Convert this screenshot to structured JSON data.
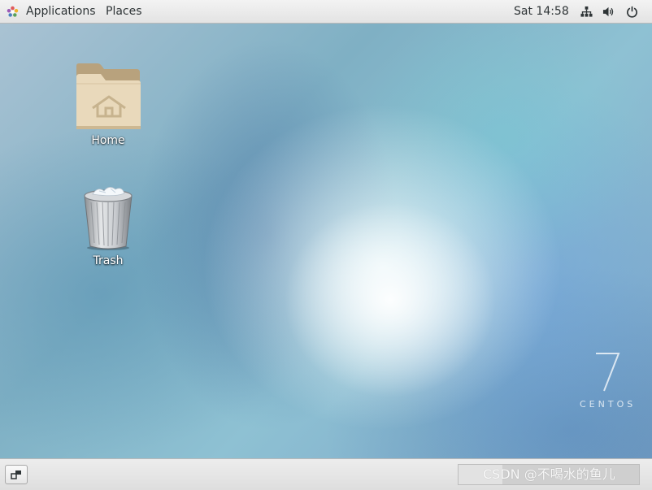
{
  "topbar": {
    "applications_label": "Applications",
    "places_label": "Places",
    "clock": "Sat 14:58",
    "icons": [
      "applications-icon",
      "network-icon",
      "volume-icon",
      "power-icon"
    ]
  },
  "desktop": {
    "items": [
      {
        "label": "Home",
        "icon": "home-folder-icon"
      },
      {
        "label": "Trash",
        "icon": "trash-icon"
      }
    ],
    "branding": {
      "version": "7",
      "name": "CENTOS"
    }
  },
  "bottombar": {
    "icons": [
      "show-desktop-icon"
    ],
    "watermark": "CSDN @不喝水的鱼儿"
  },
  "colors": {
    "panel": "#ebebeb",
    "folder": "#e7d7b9",
    "text_dark": "#2e3436",
    "label_text": "#ffffff"
  }
}
